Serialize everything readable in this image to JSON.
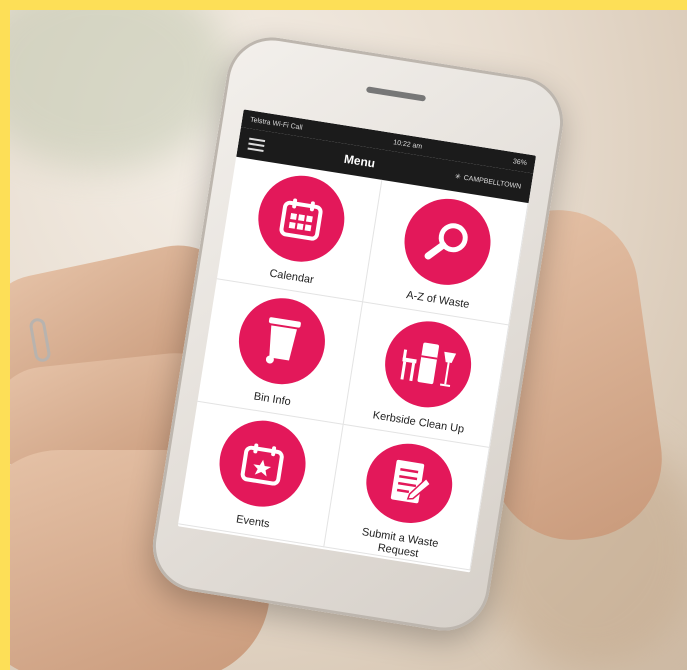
{
  "status": {
    "carrier": "Telstra Wi-Fi Call",
    "time": "10:22 am",
    "battery": "36%"
  },
  "header": {
    "title": "Menu",
    "brand": "CAMPBELLTOWN"
  },
  "colors": {
    "accent": "#e3185a",
    "bar": "#1b1b1b",
    "frame": "#fddf57"
  },
  "tiles": [
    {
      "label": "Calendar",
      "icon": "calendar-icon"
    },
    {
      "label": "A-Z of Waste",
      "icon": "magnifier-icon"
    },
    {
      "label": "Bin Info",
      "icon": "wheelie-bin-icon"
    },
    {
      "label": "Kerbside Clean Up",
      "icon": "furniture-icon"
    },
    {
      "label": "Events",
      "icon": "event-calendar-star-icon"
    },
    {
      "label": "Submit a Waste Request",
      "icon": "document-pen-icon"
    }
  ]
}
